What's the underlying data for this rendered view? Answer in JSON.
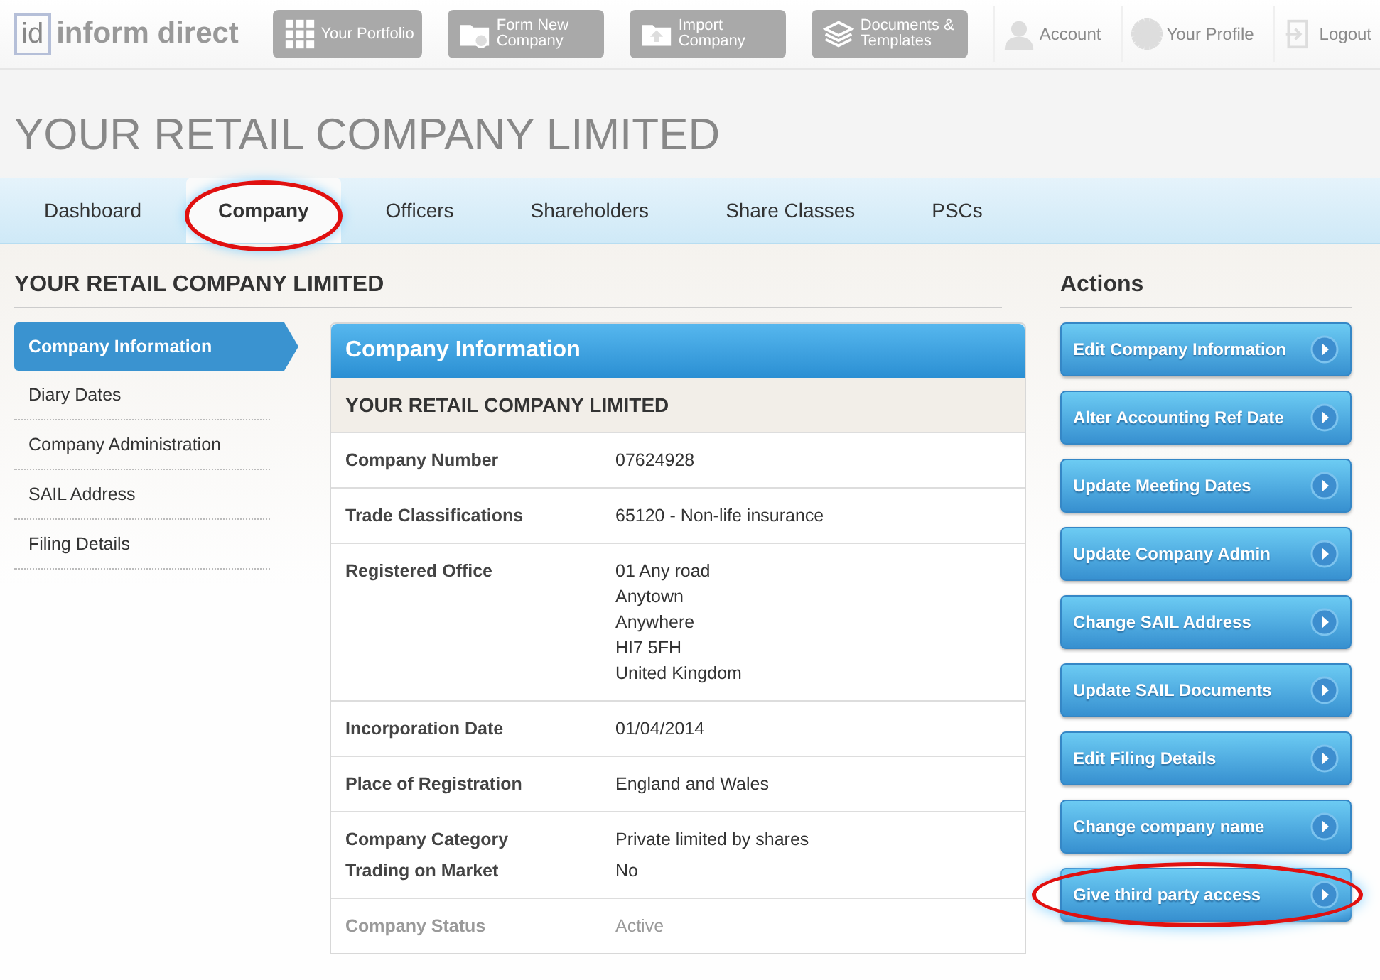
{
  "header": {
    "logo_mark": "id",
    "logo_text": "inform direct",
    "nav": [
      {
        "label": "Your Portfolio",
        "kind": "grid"
      },
      {
        "label": "Form New Company",
        "kind": "folder"
      },
      {
        "label": "Import Company",
        "kind": "upload"
      },
      {
        "label": "Documents & Templates",
        "kind": "stack"
      }
    ],
    "links": [
      {
        "label": "Account",
        "kind": "person"
      },
      {
        "label": "Your Profile",
        "kind": "gear"
      },
      {
        "label": "Logout",
        "kind": "logout"
      }
    ]
  },
  "page_title": "YOUR RETAIL COMPANY LIMITED",
  "tabs": [
    {
      "label": "Dashboard",
      "selected": false,
      "circled": false
    },
    {
      "label": "Company",
      "selected": true,
      "circled": true
    },
    {
      "label": "Officers",
      "selected": false,
      "circled": false
    },
    {
      "label": "Shareholders",
      "selected": false,
      "circled": false
    },
    {
      "label": "Share Classes",
      "selected": false,
      "circled": false
    },
    {
      "label": "PSCs",
      "selected": false,
      "circled": false
    }
  ],
  "section_title": "YOUR RETAIL COMPANY LIMITED",
  "sidebar": {
    "items": [
      {
        "label": "Company Information",
        "selected": true
      },
      {
        "label": "Diary Dates",
        "selected": false
      },
      {
        "label": "Company Administration",
        "selected": false
      },
      {
        "label": "SAIL Address",
        "selected": false
      },
      {
        "label": "Filing Details",
        "selected": false
      }
    ]
  },
  "panel": {
    "title": "Company Information",
    "subtitle": "YOUR RETAIL COMPANY LIMITED",
    "rows": [
      {
        "faded": false,
        "fields": [
          {
            "label": "Company Number",
            "value": [
              "07624928"
            ]
          }
        ]
      },
      {
        "faded": false,
        "fields": [
          {
            "label": "Trade Classifications",
            "value": [
              "65120 - Non-life insurance"
            ]
          }
        ]
      },
      {
        "faded": false,
        "fields": [
          {
            "label": "Registered Office",
            "value": [
              "01 Any road",
              "Anytown",
              "Anywhere",
              "HI7 5FH",
              "United Kingdom"
            ]
          }
        ]
      },
      {
        "faded": false,
        "fields": [
          {
            "label": "Incorporation Date",
            "value": [
              "01/04/2014"
            ]
          }
        ]
      },
      {
        "faded": false,
        "fields": [
          {
            "label": "Place of Registration",
            "value": [
              "England and Wales"
            ]
          }
        ]
      },
      {
        "faded": false,
        "fields": [
          {
            "label": "Company Category",
            "value": [
              "Private limited by shares"
            ]
          },
          {
            "label": "Trading on Market",
            "value": [
              "No"
            ]
          }
        ]
      },
      {
        "faded": true,
        "fields": [
          {
            "label": "Company Status",
            "value": [
              "Active"
            ]
          }
        ]
      }
    ]
  },
  "actions": {
    "title": "Actions",
    "buttons": [
      {
        "label": "Edit Company Information",
        "circled": false
      },
      {
        "label": "Alter Accounting Ref Date",
        "circled": false
      },
      {
        "label": "Update Meeting Dates",
        "circled": false
      },
      {
        "label": "Update Company Admin",
        "circled": false
      },
      {
        "label": "Change SAIL Address",
        "circled": false
      },
      {
        "label": "Update SAIL Documents",
        "circled": false
      },
      {
        "label": "Edit Filing Details",
        "circled": false
      },
      {
        "label": "Change company name",
        "circled": false
      },
      {
        "label": "Give third party access",
        "circled": true
      }
    ]
  }
}
